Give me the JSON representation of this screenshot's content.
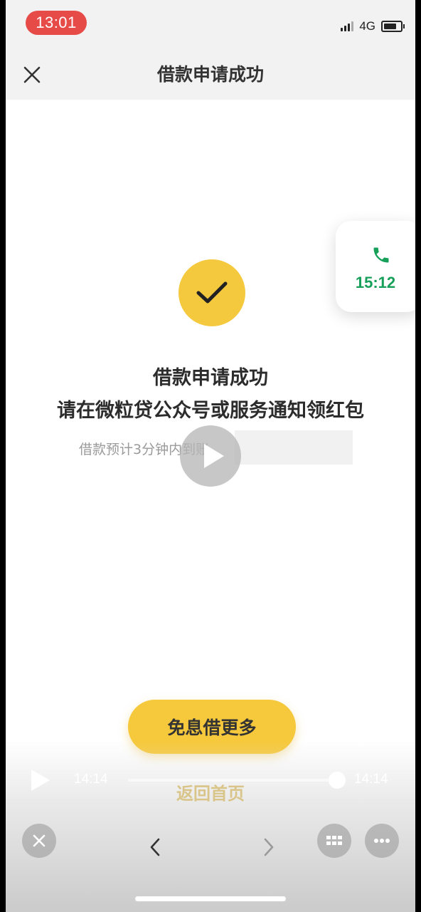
{
  "status_bar": {
    "time": "13:01",
    "network": "4G"
  },
  "header": {
    "title": "借款申请成功"
  },
  "call_bubble": {
    "time": "15:12"
  },
  "result": {
    "line1": "借款申请成功",
    "line2": "请在微粒贷公众号或服务通知领红包",
    "note": "借款预计3分钟内到账"
  },
  "actions": {
    "primary_label": "免息借更多",
    "secondary_label": "返回首页"
  },
  "video": {
    "current_time": "14:14",
    "total_time": "14:14",
    "progress": 1.0
  },
  "colors": {
    "accent": "#f6c83b",
    "call_green": "#17a05a",
    "status_red": "#e64b47"
  }
}
